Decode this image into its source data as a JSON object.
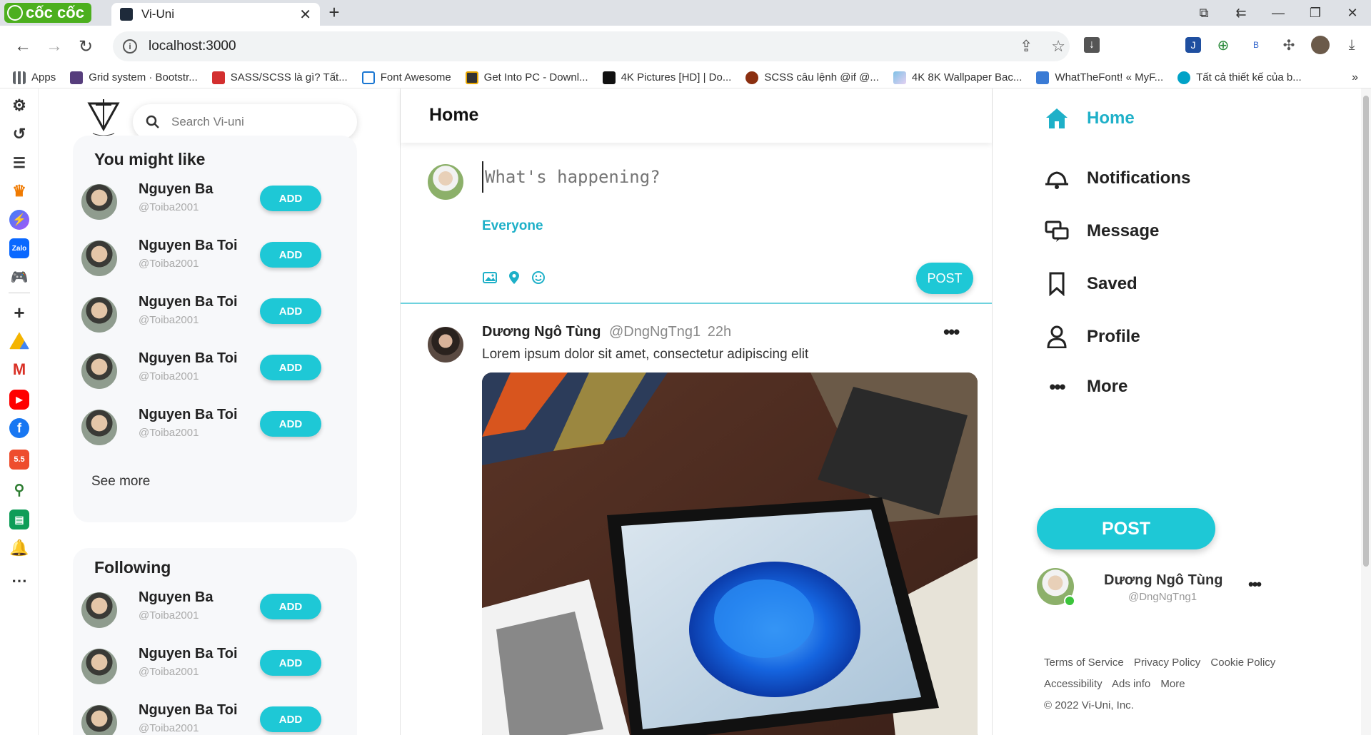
{
  "browser": {
    "brand": "cốc cốc",
    "tab_title": "Vi-Uni",
    "address": "localhost:3000",
    "bookmarks": [
      {
        "label": "Apps",
        "color": "#5f6368"
      },
      {
        "label": "Grid system · Bootstr...",
        "color": "#563d7c"
      },
      {
        "label": "SASS/SCSS là gì? Tất...",
        "color": "#d32f2f"
      },
      {
        "label": "Font Awesome",
        "color": "#1976d2"
      },
      {
        "label": "Get Into PC - Downl...",
        "color": "#333333"
      },
      {
        "label": "4K Pictures [HD] | Do...",
        "color": "#111111"
      },
      {
        "label": "SCSS câu lệnh @if @...",
        "color": "#8b2f10"
      },
      {
        "label": "4K 8K Wallpaper Bac...",
        "color": "#7ec1e6"
      },
      {
        "label": "WhatTheFont! « MyF...",
        "color": "#3a7bd5"
      },
      {
        "label": "Tất cả thiết kế của b...",
        "color": "#00a2c7"
      }
    ]
  },
  "app": {
    "search_placeholder": "Search Vi-uni",
    "you_might_like": {
      "title": "You might like",
      "people": [
        {
          "name": "Nguyen Ba",
          "handle": "@Toiba2001",
          "button": "ADD"
        },
        {
          "name": "Nguyen Ba Toi",
          "handle": "@Toiba2001",
          "button": "ADD"
        },
        {
          "name": "Nguyen Ba Toi",
          "handle": "@Toiba2001",
          "button": "ADD"
        },
        {
          "name": "Nguyen Ba Toi",
          "handle": "@Toiba2001",
          "button": "ADD"
        },
        {
          "name": "Nguyen Ba Toi",
          "handle": "@Toiba2001",
          "button": "ADD"
        }
      ],
      "see_more": "See more"
    },
    "following": {
      "title": "Following",
      "people": [
        {
          "name": "Nguyen Ba",
          "handle": "@Toiba2001",
          "button": "ADD"
        },
        {
          "name": "Nguyen Ba Toi",
          "handle": "@Toiba2001",
          "button": "ADD"
        },
        {
          "name": "Nguyen Ba Toi",
          "handle": "@Toiba2001",
          "button": "ADD"
        }
      ]
    },
    "center": {
      "title": "Home",
      "compose_placeholder": "What's happening?",
      "audience": "Everyone",
      "post_button": "POST"
    },
    "post": {
      "author": "Dương Ngô Tùng",
      "handle": "@DngNgTng1",
      "time": "22h",
      "text": "Lorem ipsum dolor sit amet, consectetur adipiscing elit",
      "image_icon": "laptop-with-windows-11-photo"
    },
    "nav": [
      {
        "label": "Home",
        "icon": "home-icon"
      },
      {
        "label": "Notifications",
        "icon": "bell-icon"
      },
      {
        "label": "Message",
        "icon": "chat-icon"
      },
      {
        "label": "Saved",
        "icon": "bookmark-icon"
      },
      {
        "label": "Profile",
        "icon": "user-icon"
      },
      {
        "label": "More",
        "icon": "more-icon"
      }
    ],
    "post_big": "POST",
    "me": {
      "name": "Dương Ngô Tùng",
      "handle": "@DngNgTng1"
    },
    "footer": {
      "links": [
        "Terms of Service",
        "Privacy Policy",
        "Cookie Policy",
        "Accessibility",
        "Ads info",
        "More"
      ],
      "copyright": "© 2022 Vi-Uni, Inc."
    },
    "accent": "#1ec8d6"
  }
}
